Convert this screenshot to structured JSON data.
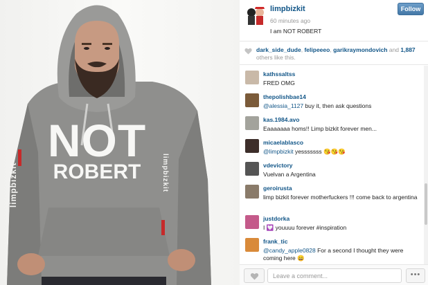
{
  "post": {
    "username": "limpbizkit",
    "time_ago": "60 minutes ago",
    "caption": "I am NOT ROBERT",
    "follow_label": "Follow"
  },
  "photo": {
    "hoodie_line1": "NOT",
    "hoodie_line2": "ROBERT",
    "sleeve_left": "limpbizkit",
    "sleeve_right": "limpbizkit"
  },
  "likes": {
    "users": [
      "dark_side_dude",
      "felipeeeo",
      "garikraymondovich"
    ],
    "sep1": ", ",
    "sep2": ", ",
    "and": " and ",
    "count": "1,887",
    "suffix": "others like this."
  },
  "comments": [
    {
      "user": "kathssaltss",
      "mention": "",
      "text": "FRED OMG",
      "avatar_color": "#c9b9a8"
    },
    {
      "user": "thepolishbae14",
      "mention": "@alessia_1127",
      "text": " buy it, then ask questions",
      "avatar_color": "#7b5b3a"
    },
    {
      "user": "kas.1984.avo",
      "mention": "",
      "text": "Eaaaaaaa homs!! Limp bizkit forever men...",
      "avatar_color": "#a3a39c"
    },
    {
      "user": "micaelablasco",
      "mention": "@limpbizkit",
      "text": " yesssssss 😘😘😘",
      "avatar_color": "#3d2e2a"
    },
    {
      "user": "vdevictory",
      "mention": "",
      "text": "Vuelvan a Argentina",
      "avatar_color": "#555555"
    },
    {
      "user": "geroirusta",
      "mention": "",
      "text": "limp bizkit forever motherfuckers !!! come back to argentina",
      "avatar_color": "#8a7b6a"
    },
    {
      "user": "justdorka",
      "mention": "",
      "text": "I 💟 youuuu forever #inspiration",
      "avatar_color": "#c45a8a"
    },
    {
      "user": "frank_tic",
      "mention": "@candy_apple0828",
      "text": " For a second I thought they were coming here 😄",
      "avatar_color": "#d98a3a"
    }
  ],
  "footer": {
    "comment_placeholder": "Leave a comment...",
    "more_label": "•••"
  },
  "colors": {
    "link": "#125688",
    "follow_button": "#4478a7"
  }
}
